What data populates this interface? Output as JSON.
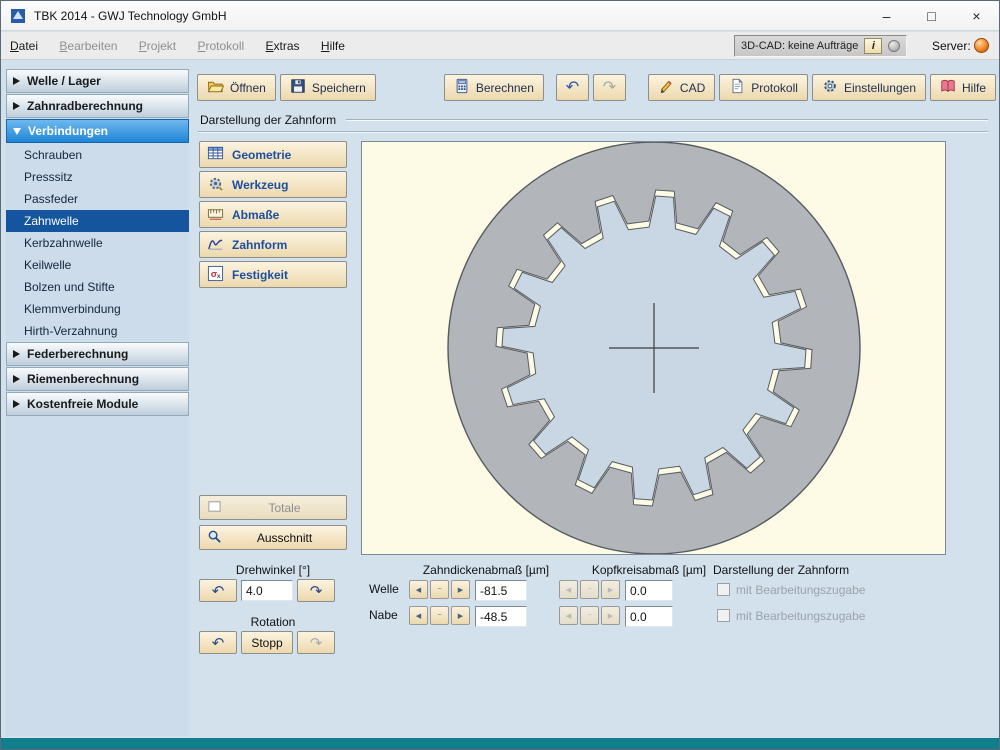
{
  "window": {
    "title": "TBK 2014 - GWJ Technology GmbH",
    "minimize": "–",
    "maximize": "□",
    "close": "×"
  },
  "menubar": {
    "items": [
      "Datei",
      "Bearbeiten",
      "Projekt",
      "Protokoll",
      "Extras",
      "Hilfe"
    ],
    "cad_status": "3D-CAD: keine Aufträge",
    "info_button": "i",
    "server_label": "Server:"
  },
  "sidebar": {
    "sections": [
      {
        "label": "Welle / Lager"
      },
      {
        "label": "Zahnradberechnung"
      },
      {
        "label": "Verbindungen"
      },
      {
        "label": "Federberechnung"
      },
      {
        "label": "Riemenberechnung"
      },
      {
        "label": "Kostenfreie Module"
      }
    ],
    "verbindungen_items": [
      "Schrauben",
      "Presssitz",
      "Passfeder",
      "Zahnwelle",
      "Kerbzahnwelle",
      "Keilwelle",
      "Bolzen und Stifte",
      "Klemmverbindung",
      "Hirth-Verzahnung"
    ]
  },
  "toolbar": {
    "open": "Öffnen",
    "save": "Speichern",
    "calculate": "Berechnen",
    "undo": "↶",
    "redo": "↷",
    "cad": "CAD",
    "protocol": "Protokoll",
    "settings": "Einstellungen",
    "help": "Hilfe"
  },
  "content": {
    "section_title": "Darstellung der Zahnform",
    "nav_buttons": [
      "Geometrie",
      "Werkzeug",
      "Abmaße",
      "Zahnform",
      "Festigkeit"
    ],
    "view_total": "Totale",
    "view_detail": "Ausschnitt"
  },
  "controls": {
    "drehwinkel_label": "Drehwinkel [°]",
    "drehwinkel_value": "4.0",
    "rotation_label": "Rotation",
    "stop_button": "Stopp",
    "zahndicken_label": "Zahndickenabmaß [µm]",
    "kopfkreis_label": "Kopfkreisabmaß [µm]",
    "darstellung_label": "Darstellung der Zahnform",
    "welle_label": "Welle",
    "nabe_label": "Nabe",
    "zahndicken_welle": "-81.5",
    "zahndicken_nabe": "-48.5",
    "kopfkreis_welle": "0.0",
    "kopfkreis_nabe": "0.0",
    "checkbox1_label": "mit Bearbeitungszugabe",
    "checkbox2_label": "mit Bearbeitungszugabe"
  },
  "glyphs": {
    "spin_left": "◀",
    "spin_minus": "−",
    "spin_right": "▶",
    "rotate_left": "↶",
    "rotate_right": "↷"
  },
  "gear": {
    "teeth": 16,
    "rotation_deg": 4,
    "outer_radius": 206,
    "hole_tip_radius": 158,
    "hole_root_radius": 127,
    "shaft_tip_radius": 152,
    "shaft_root_radius": 121,
    "hub_color": "#b2b6ba",
    "shaft_color": "#c9d6e3",
    "outline_color": "#555b60",
    "canvas_color": "#fdfbe6",
    "crosshair_color": "#3c3c3c"
  }
}
